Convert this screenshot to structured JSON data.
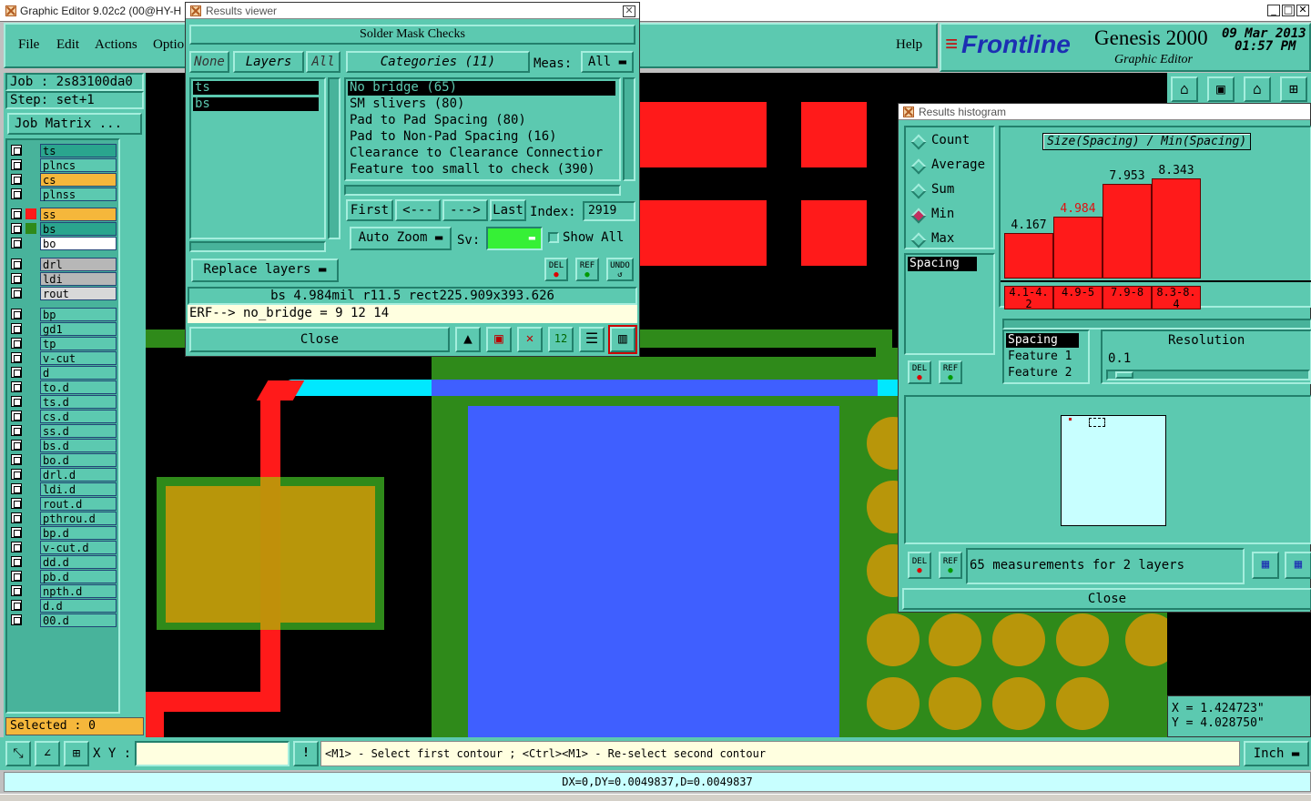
{
  "app": {
    "title": "Graphic Editor 9.02c2 (00@HY-H",
    "menus": [
      "File",
      "Edit",
      "Actions",
      "Optio"
    ],
    "help": "Help",
    "brand": "Frontline",
    "product": "Genesis 2000",
    "subtitle": "Graphic Editor",
    "date": "09 Mar 2013",
    "time": "01:57 PM"
  },
  "left": {
    "job": "Job : 2s83100da0",
    "step": "Step: set+1",
    "job_matrix": "Job Matrix ...",
    "selected": "Selected : 0",
    "layers": [
      {
        "name": "ts",
        "color": "#2aa58e"
      },
      {
        "name": "plncs",
        "color": "#5cc9b0"
      },
      {
        "name": "cs",
        "color": "#f5b73b"
      },
      {
        "name": "plnss",
        "color": "#5cc9b0"
      },
      {
        "name": "ss",
        "color": "#f5b73b"
      },
      {
        "name": "bs",
        "color": "#2aa58e"
      },
      {
        "name": "bo",
        "color": "#ffffff"
      },
      {
        "name": "drl",
        "color": "#b7b7b7"
      },
      {
        "name": "ldi",
        "color": "#b7b7b7"
      },
      {
        "name": "rout",
        "color": "#d8d8d8"
      },
      {
        "name": "bp",
        "color": "#5cc9b0"
      },
      {
        "name": "gd1",
        "color": "#5cc9b0"
      },
      {
        "name": "tp",
        "color": "#5cc9b0"
      },
      {
        "name": "v-cut",
        "color": "#5cc9b0"
      },
      {
        "name": "d",
        "color": "#5cc9b0"
      },
      {
        "name": "to.d",
        "color": "#5cc9b0"
      },
      {
        "name": "ts.d",
        "color": "#5cc9b0"
      },
      {
        "name": "cs.d",
        "color": "#5cc9b0"
      },
      {
        "name": "ss.d",
        "color": "#5cc9b0"
      },
      {
        "name": "bs.d",
        "color": "#5cc9b0"
      },
      {
        "name": "bo.d",
        "color": "#5cc9b0"
      },
      {
        "name": "drl.d",
        "color": "#5cc9b0"
      },
      {
        "name": "ldi.d",
        "color": "#5cc9b0"
      },
      {
        "name": "rout.d",
        "color": "#5cc9b0"
      },
      {
        "name": "pthrou.d",
        "color": "#5cc9b0"
      },
      {
        "name": "bp.d",
        "color": "#5cc9b0"
      },
      {
        "name": "v-cut.d",
        "color": "#5cc9b0"
      },
      {
        "name": "dd.d",
        "color": "#5cc9b0"
      },
      {
        "name": "pb.d",
        "color": "#5cc9b0"
      },
      {
        "name": "npth.d",
        "color": "#5cc9b0"
      },
      {
        "name": "d.d",
        "color": "#5cc9b0"
      },
      {
        "name": "00.d",
        "color": "#5cc9b0"
      }
    ]
  },
  "results": {
    "window_title": "Results viewer",
    "header": "Solder Mask Checks",
    "none": "None",
    "layers_btn": "Layers",
    "all": "All",
    "categories_btn": "Categories (11)",
    "meas_label": "Meas:",
    "meas_value": "All",
    "layer_items": [
      "ts",
      "bs"
    ],
    "categories": [
      "No bridge (65)",
      "SM slivers (80)",
      "Pad to Pad Spacing (80)",
      "Pad to Non-Pad Spacing (16)",
      "Clearance to Clearance Connectior",
      "Feature too small to check (390)"
    ],
    "first": "First",
    "prev": "<---",
    "next": "--->",
    "last": "Last",
    "index_label": "Index:",
    "index_value": "2919",
    "auto_zoom": "Auto Zoom",
    "sv_label": "Sv:",
    "show_all": "Show All",
    "replace_layers": "Replace layers",
    "del": "DEL",
    "ref": "REF",
    "undo": "UNDO",
    "info": "bs 4.984mil   r11.5   rect225.909x393.626",
    "erf": "ERF--> no_bridge = 9 12 14",
    "close": "Close"
  },
  "histogram": {
    "window_title": "Results histogram",
    "options": [
      "Count",
      "Average",
      "Sum",
      "Min",
      "Max"
    ],
    "selected_option": "Min",
    "list_item": "Spacing",
    "chart_title": "Size(Spacing) / Min(Spacing)",
    "bars": [
      {
        "value": "4.167",
        "range": "4.1-4.2",
        "h": 0.42
      },
      {
        "value": "4.984",
        "range": "4.9-5",
        "h": 0.57
      },
      {
        "value": "7.953",
        "range": "7.9-8",
        "h": 0.87
      },
      {
        "value": "8.343",
        "range": "8.3-8.4",
        "h": 0.92
      }
    ],
    "highlight_index": 1,
    "fields": [
      "Spacing",
      "Feature 1",
      "Feature 2"
    ],
    "resolution_label": "Resolution",
    "resolution_value": "0.1",
    "status": "65 measurements for 2 layers",
    "del": "DEL",
    "ref": "REF",
    "close": "Close"
  },
  "coords": {
    "x": "X = 1.424723\"",
    "y": "Y = 4.028750\""
  },
  "bottom": {
    "xy_label": "X Y :",
    "xy_value": "",
    "excl": "!",
    "hint": "<M1> - Select first contour ; <Ctrl><M1> - Re-select second contour",
    "units": "Inch",
    "status": "DX=0,DY=0.0049837,D=0.0049837"
  }
}
